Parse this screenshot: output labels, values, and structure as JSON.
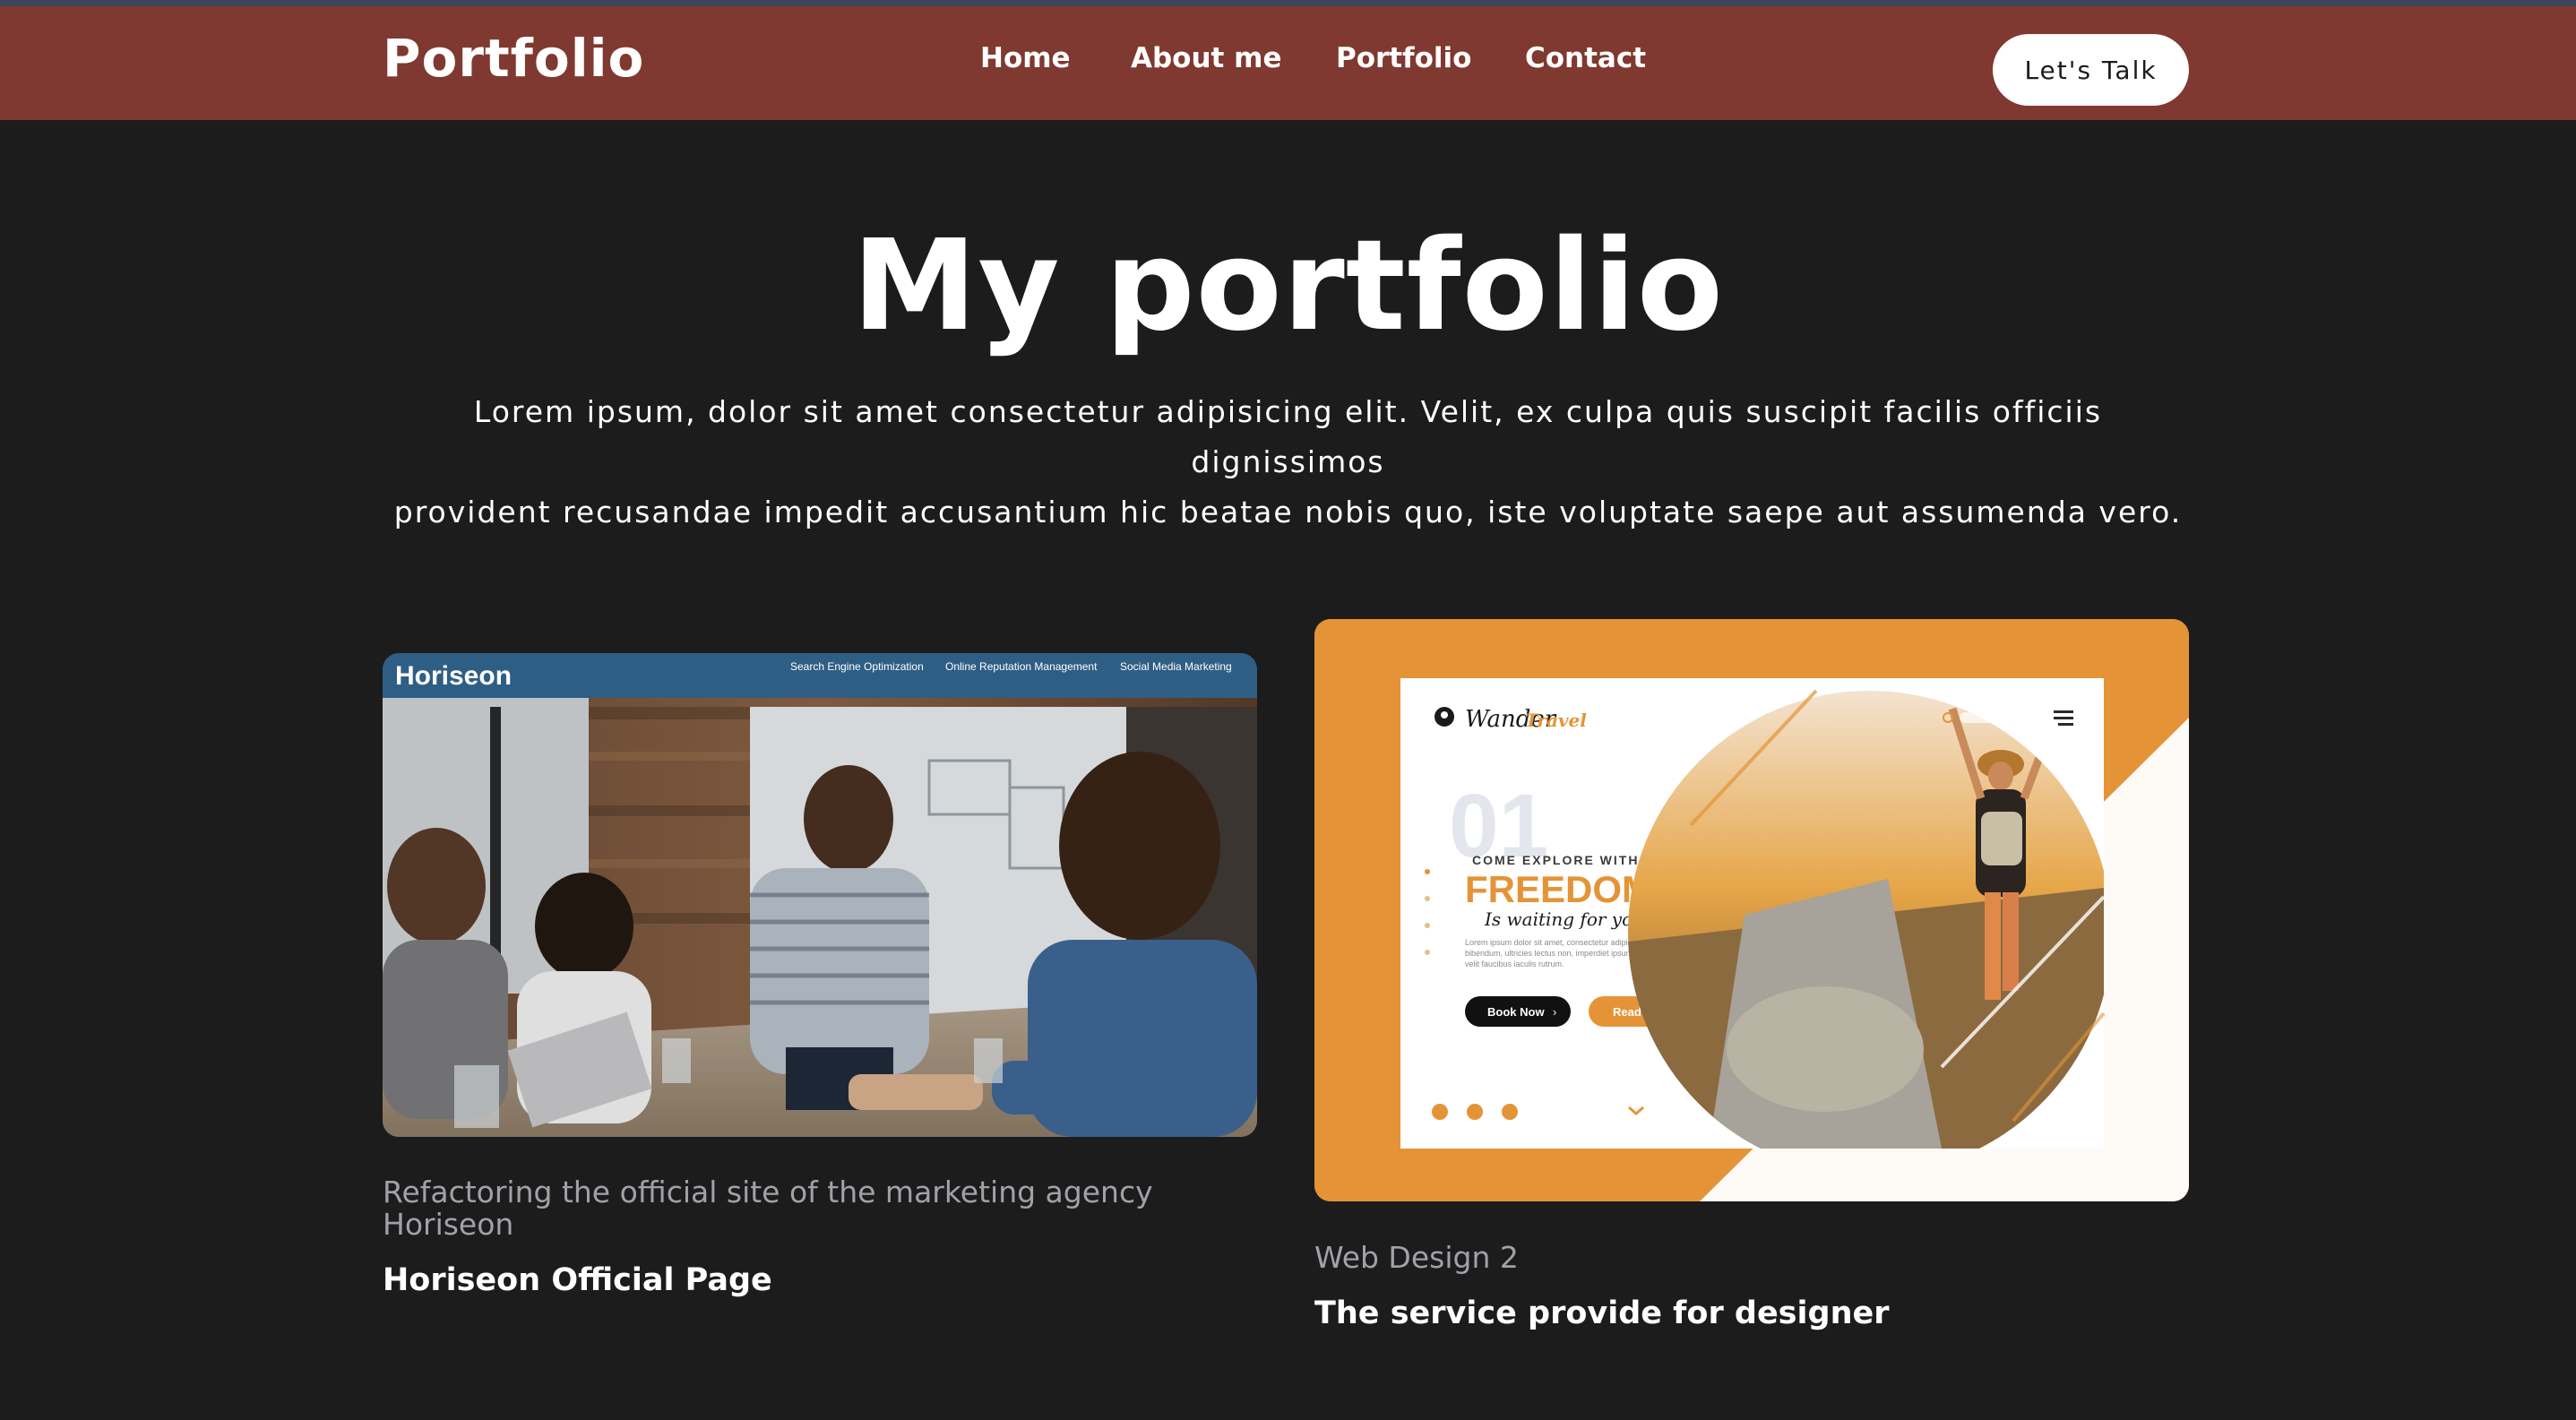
{
  "nav": {
    "brand": "Portfolio",
    "links": [
      "Home",
      "About me",
      "Portfolio",
      "Contact"
    ],
    "cta": "Let's Talk"
  },
  "hero": {
    "title": "My portfolio",
    "description_line1": "Lorem ipsum, dolor sit amet consectetur adipisicing elit. Velit, ex culpa quis suscipit facilis officiis dignissimos",
    "description_line2": "provident recusandae impedit accusantium hic beatae nobis quo, iste voluptate saepe aut assumenda vero."
  },
  "projects": [
    {
      "caption": "Refactoring the official site of the marketing agency Horiseon",
      "title": "Horiseon Official Page",
      "screenshot": {
        "logo": "Horiseon",
        "menu": [
          "Search Engine Optimization",
          "Online Reputation Management",
          "Social Media Marketing"
        ]
      }
    },
    {
      "caption": "Web Design 2",
      "title": "The service provide for designer",
      "screenshot": {
        "logo_a": "Wander",
        "logo_b": "Travel",
        "big_number": "01",
        "kicker": "COME EXPLORE WITH US!",
        "headline": "FREEDOM",
        "script": "Is waiting for you!",
        "body": "Lorem ipsum dolor sit amet, consectetur adipiscing elit. Duis at justo bibendum, ultricies lectus non, imperdiet ipsum. Mauris fringilla felis ac velit faucibus iaculis rutrum.",
        "btn_primary": "Book Now",
        "btn_secondary": "Read More"
      }
    }
  ],
  "colors": {
    "navbar": "#7f3930",
    "background": "#1c1c1d",
    "accent": "#e49437"
  }
}
